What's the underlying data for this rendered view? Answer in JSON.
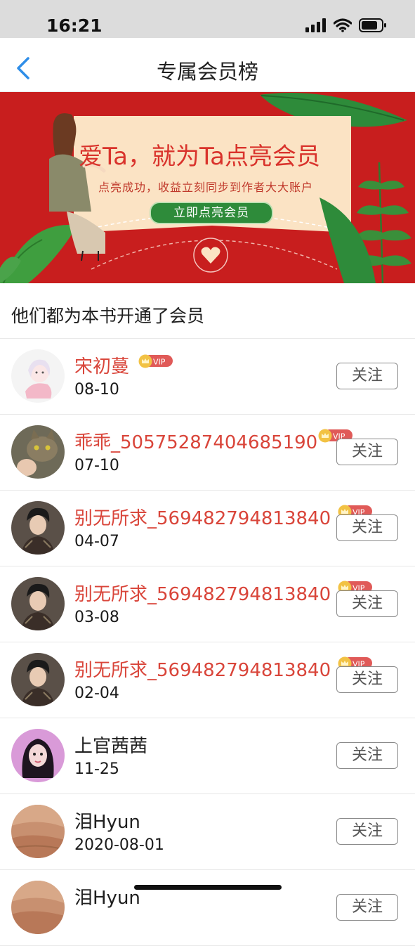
{
  "status_bar": {
    "time": "16:21"
  },
  "nav": {
    "title": "专属会员榜"
  },
  "banner": {
    "headline": "爱Ta，就为Ta点亮会员",
    "subline": "点亮成功，收益立刻同步到作者大大账户",
    "cta": "立即点亮会员",
    "colors": {
      "background": "#c81e1e",
      "card": "#fbe3c4",
      "cta": "#2e8b3a",
      "headline": "#d9332c"
    }
  },
  "section_title": "他们都为本书开通了会员",
  "vip_label": "VIP",
  "follow_label": "关注",
  "members": [
    {
      "name": "宋初蔓",
      "date": "08-10",
      "vip": true,
      "avatar": "anime-girl-avatar"
    },
    {
      "name": "乖乖_50575287404685190",
      "date": "07-10",
      "vip": true,
      "avatar": "cat-avatar"
    },
    {
      "name": "别无所求_569482794813840",
      "date": "04-07",
      "vip": true,
      "avatar": "man-portrait-avatar"
    },
    {
      "name": "别无所求_569482794813840",
      "date": "03-08",
      "vip": true,
      "avatar": "man-portrait-avatar"
    },
    {
      "name": "别无所求_569482794813840",
      "date": "02-04",
      "vip": true,
      "avatar": "man-portrait-avatar"
    },
    {
      "name": "上官茜茜",
      "date": "11-25",
      "vip": false,
      "avatar": "girl-portrait-avatar"
    },
    {
      "name": "泪Hyun",
      "date": "2020-08-01",
      "vip": false,
      "avatar": "desert-avatar"
    },
    {
      "name": "泪Hyun",
      "date": "",
      "vip": false,
      "avatar": "desert-avatar"
    }
  ]
}
